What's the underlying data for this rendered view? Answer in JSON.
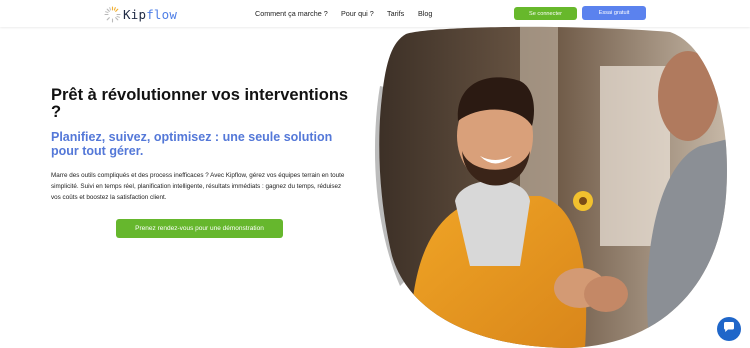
{
  "header": {
    "logo": {
      "part1": "Kip",
      "part2": "flow"
    },
    "nav": [
      {
        "label": "Comment ça marche ?"
      },
      {
        "label": "Pour qui ?"
      },
      {
        "label": "Tarifs"
      },
      {
        "label": "Blog"
      }
    ],
    "login_label": "Se connecter",
    "trial_label": "Essai gratuit"
  },
  "hero": {
    "title": "Prêt à révolutionner vos interventions ?",
    "subtitle": "Planifiez, suivez, optimisez : une seule solution pour tout gérer.",
    "body": "Marre des outils compliqués et des process inefficaces ? Avec Kipflow, gérez vos équipes terrain en toute simplicité. Suivi en temps réel, planification intelligente, résultats immédiats : gagnez du temps, réduisez vos coûts et boostez la satisfaction client.",
    "cta_label": "Prenez rendez-vous pour une démonstration"
  },
  "icons": {
    "logo": "sunburst-logo-icon",
    "chat": "chat-bubble-icon"
  },
  "colors": {
    "brand_blue": "#5478d8",
    "brand_green": "#66b72d",
    "chat_blue": "#1f66c9"
  }
}
